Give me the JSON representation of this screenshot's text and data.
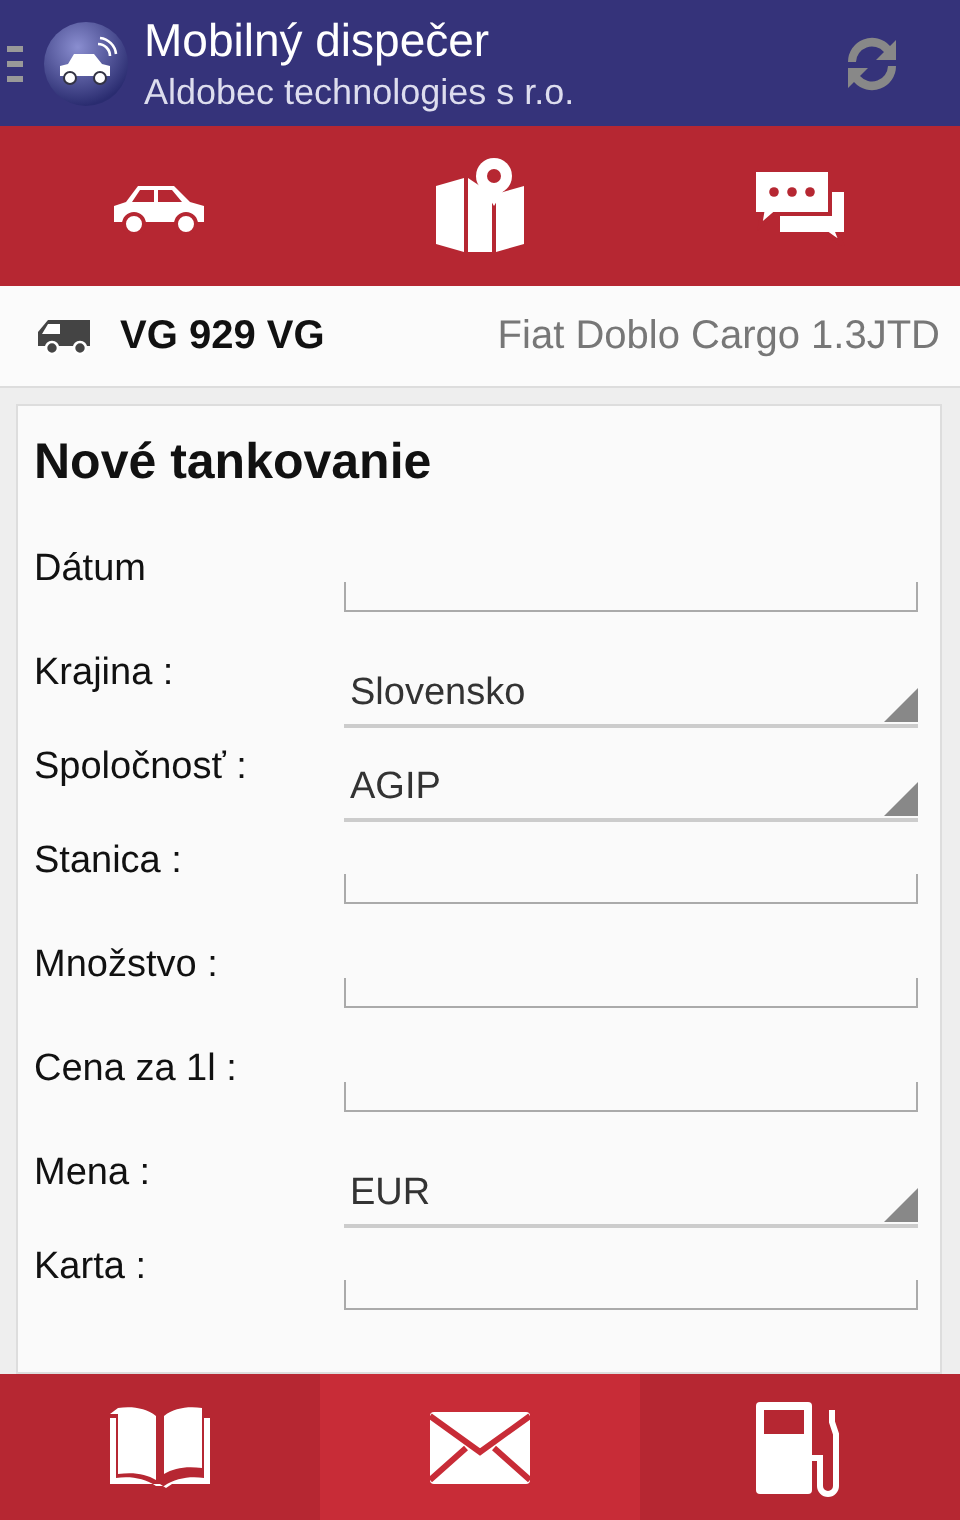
{
  "header": {
    "title": "Mobilný dispečer",
    "subtitle": "Aldobec technologies s r.o."
  },
  "vehicle": {
    "plate": "VG 929 VG",
    "model": "Fiat Doblo Cargo 1.3JTD"
  },
  "form": {
    "title": "Nové tankovanie",
    "fields": [
      {
        "label": "Dátum",
        "kind": "text"
      },
      {
        "label": "Krajina :",
        "kind": "select",
        "value": "Slovensko"
      },
      {
        "label": "Spoločnosť :",
        "kind": "select",
        "value": "AGIP"
      },
      {
        "label": "Stanica :",
        "kind": "text"
      },
      {
        "label": "Množstvo :",
        "kind": "text"
      },
      {
        "label": "Cena za 1l :",
        "kind": "text"
      },
      {
        "label": "Mena :",
        "kind": "select",
        "value": "EUR"
      },
      {
        "label": "Karta :",
        "kind": "text"
      }
    ]
  },
  "bottom_nav": [
    {
      "kind": "book",
      "selected": false
    },
    {
      "kind": "mail",
      "selected": true
    },
    {
      "kind": "fuel",
      "selected": false
    }
  ]
}
